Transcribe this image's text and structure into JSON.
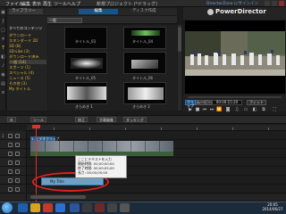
{
  "window": {
    "menu": [
      "ファイル",
      "編集",
      "表示",
      "再生",
      "ツール",
      "ヘルプ"
    ],
    "project_title": "新規プロジェクト (*ドラッグ)",
    "promo_link": "DirectorZone にサインイン",
    "app_name": "PowerDirector"
  },
  "tabs": {
    "media": "ライブラリー",
    "fx": "編集",
    "disc": "ディスク作成"
  },
  "library": {
    "dropdown": "一般",
    "categories": [
      {
        "label": "すべてのコンテンツ",
        "selected": false
      },
      {
        "label": "ダウンロード",
        "selected": false
      },
      {
        "label": "スタンダード 2D",
        "selected": false
      },
      {
        "label": "3D (B)",
        "selected": false
      },
      {
        "label": "3D-Like (3)",
        "selected": false
      },
      {
        "label": "ダウンロード済み",
        "selected": false
      },
      {
        "label": "一般 (14)",
        "selected": true
      },
      {
        "label": "スポーツ (1)",
        "selected": false
      },
      {
        "label": "スペシャル (4)",
        "selected": false
      },
      {
        "label": "ニュース (5)",
        "selected": false
      },
      {
        "label": "その他 (3)",
        "selected": false
      },
      {
        "label": "My タイトル",
        "selected": false
      }
    ],
    "thumbnails": [
      {
        "label": "タイトル_03"
      },
      {
        "label": "タイトル_04"
      },
      {
        "label": "タイトル_05"
      },
      {
        "label": "タイトル_06"
      },
      {
        "label": "きらめき 1"
      },
      {
        "label": "きらめき 2"
      },
      {
        "label": "フレーム 1"
      },
      {
        "label": "フレーム 2"
      }
    ]
  },
  "player": {
    "clip_label": "クリップ",
    "film_label": "ムービー",
    "timecode": "00:00:15:20",
    "fit_label": "フィット"
  },
  "midbar": {
    "buttons": [
      "ツール",
      "修正",
      "字幕編集",
      "ダッキング"
    ]
  },
  "timeline": {
    "clip_label": "1. ビデオクリップ",
    "text_clip": "My Title",
    "tooltip": [
      "ここにテキストを入力",
      "開始時間: 00;00;00;00",
      "終了時間: 00;00;05;00",
      "長さ: 00;00;05;00"
    ]
  },
  "taskbar": {
    "time": "20:05",
    "date": "2014/06/27"
  },
  "colors": {
    "accent": "#15548f",
    "highlight": "#e02020"
  }
}
